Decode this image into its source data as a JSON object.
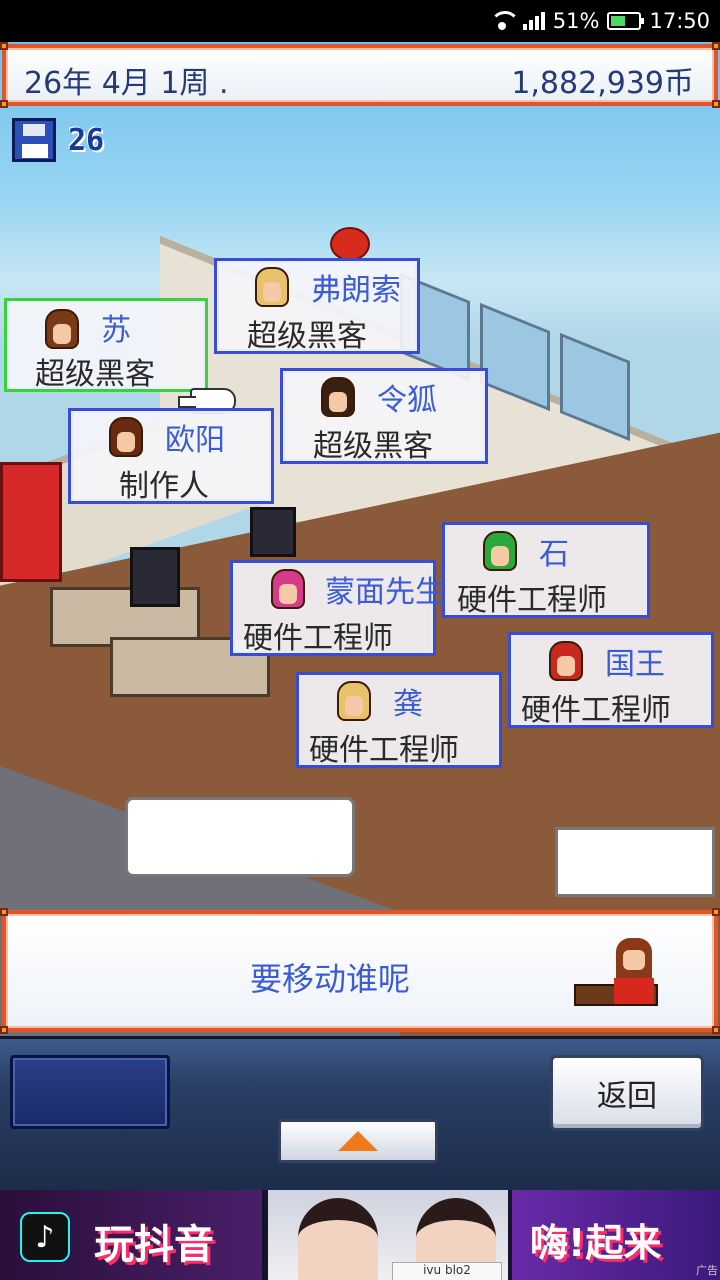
{
  "status_bar": {
    "battery_percent": "51%",
    "time": "17:50"
  },
  "header": {
    "date": "26年 4月 1周 .",
    "money": "1,882,939币"
  },
  "save": {
    "count": "26"
  },
  "staff": [
    {
      "name": "苏",
      "role": "超级黑客",
      "selected": true,
      "hair_color": "#7a3a18"
    },
    {
      "name": "弗朗索",
      "role": "超级黑客",
      "selected": false,
      "hair_color": "#e8c26a"
    },
    {
      "name": "令狐",
      "role": "超级黑客",
      "selected": false,
      "hair_color": "#3a2010"
    },
    {
      "name": "欧阳",
      "role": "制作人",
      "selected": false,
      "hair_color": "#6a2a10"
    },
    {
      "name": "石",
      "role": "硬件工程师",
      "selected": false,
      "hair_color": "#2aa83a"
    },
    {
      "name": "蒙面先生",
      "role": "硬件工程师",
      "selected": false,
      "hair_color": "#d83a8a"
    },
    {
      "name": "国王",
      "role": "硬件工程师",
      "selected": false,
      "hair_color": "#c8281e"
    },
    {
      "name": "龚",
      "role": "硬件工程师",
      "selected": false,
      "hair_color": "#e8c26a"
    }
  ],
  "message": {
    "text": "要移动谁呢"
  },
  "controls": {
    "back_label": "返回"
  },
  "ad": {
    "logo_glyph": "♪",
    "slogan_left": "玩抖音",
    "shirt_text": "ivu blo2",
    "slogan_right": "嗨!起来",
    "tag": "广告"
  },
  "colors": {
    "frame_orange": "#e0552a",
    "card_border": "#3a4cd2",
    "card_selected_border": "#3ad23a",
    "name_blue": "#3a5cd6"
  }
}
